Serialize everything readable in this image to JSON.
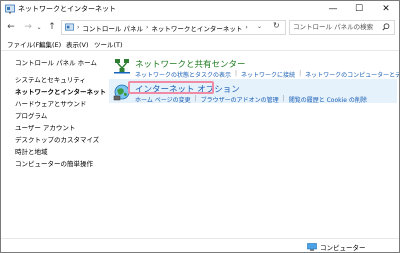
{
  "window": {
    "title": "ネットワークとインターネット",
    "controls": {
      "minimize": "—",
      "maximize": "☐",
      "close": "✕"
    }
  },
  "addressbar": {
    "breadcrumbs": [
      "コントロール パネル",
      "ネットワークとインターネット"
    ],
    "search_placeholder": "コントロール パネルの検索"
  },
  "menubar": {
    "items": [
      "ファイル(F)",
      "編集(E)",
      "表示(V)",
      "ツール(T)"
    ]
  },
  "sidebar": {
    "items": [
      {
        "label": "コントロール パネル ホーム",
        "active": false
      },
      {
        "label": "システムとセキュリティ",
        "active": false
      },
      {
        "label": "ネットワークとインターネット",
        "active": true
      },
      {
        "label": "ハードウェアとサウンド",
        "active": false
      },
      {
        "label": "プログラム",
        "active": false
      },
      {
        "label": "ユーザー アカウント",
        "active": false
      },
      {
        "label": "デスクトップのカスタマイズ",
        "active": false
      },
      {
        "label": "時計と地域",
        "active": false
      },
      {
        "label": "コンピューターの簡単操作",
        "active": false
      }
    ]
  },
  "main": {
    "categories": [
      {
        "title": "ネットワークと共有センター",
        "icon": "network-sharing-center-icon",
        "links": [
          "ネットワークの状態とタスクの表示",
          "ネットワークに接続",
          "ネットワークのコンピューターとデバイスの表示"
        ]
      },
      {
        "title": "インターネット オプション",
        "icon": "internet-options-icon",
        "links": [
          "ホーム ページの変更",
          "ブラウザーのアドオンの管理",
          "閲覧の履歴と Cookie の削除"
        ]
      }
    ]
  },
  "statusbar": {
    "location": "コンピューター"
  },
  "colors": {
    "link": "#1a5fb4",
    "category_green": "#1e7b1e",
    "hover_band": "#e5f1fb",
    "highlight_border": "#f08aa5"
  }
}
